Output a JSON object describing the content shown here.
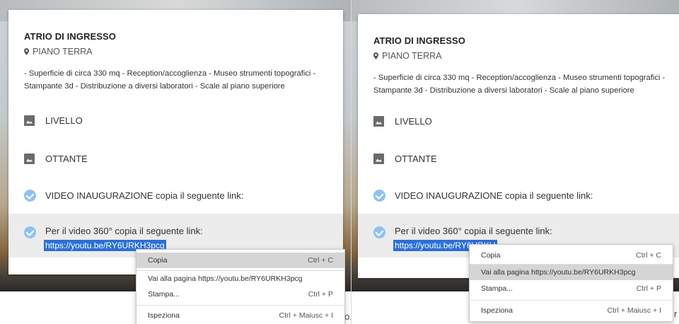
{
  "card": {
    "title": "ATRIO DI INGRESSO",
    "location": "PIANO TERRA",
    "description": "- Superficie di circa 330 mq - Reception/accoglienza - Museo strumenti topografici - Stampante 3d - Distribuzione a diversi laboratori - Scale al piano superiore",
    "items": [
      {
        "label": "LIVELLO"
      },
      {
        "label": "OTTANTE"
      },
      {
        "label": "VIDEO INAUGURAZIONE copia il seguente link:"
      },
      {
        "label": "Per il video 360° copia il seguente link:",
        "link": "https://youtu.be/RY6URKH3pcg"
      }
    ]
  },
  "left_visible_link": "https://youtu.be/RY6URKH3pcg",
  "right_visible_link": "https://youtu.be/RY6URKH",
  "context_menu": {
    "items": [
      {
        "label": "Copia",
        "shortcut": "Ctrl + C"
      },
      {
        "label": "Vai alla pagina https://youtu.be/RY6URKH3pcg",
        "shortcut": ""
      },
      {
        "label": "Stampa...",
        "shortcut": "Ctrl + P"
      },
      {
        "label": "Ispeziona",
        "shortcut": "Ctrl + Maiusc + I"
      }
    ],
    "left_selected_index": 0,
    "right_selected_index": 1
  },
  "stray_text": {
    "left": "o.",
    "right": "r"
  },
  "colors": {
    "selection": "#2b6fd6",
    "check": "#90c2ef",
    "menu_highlight": "#d5d5d5"
  }
}
